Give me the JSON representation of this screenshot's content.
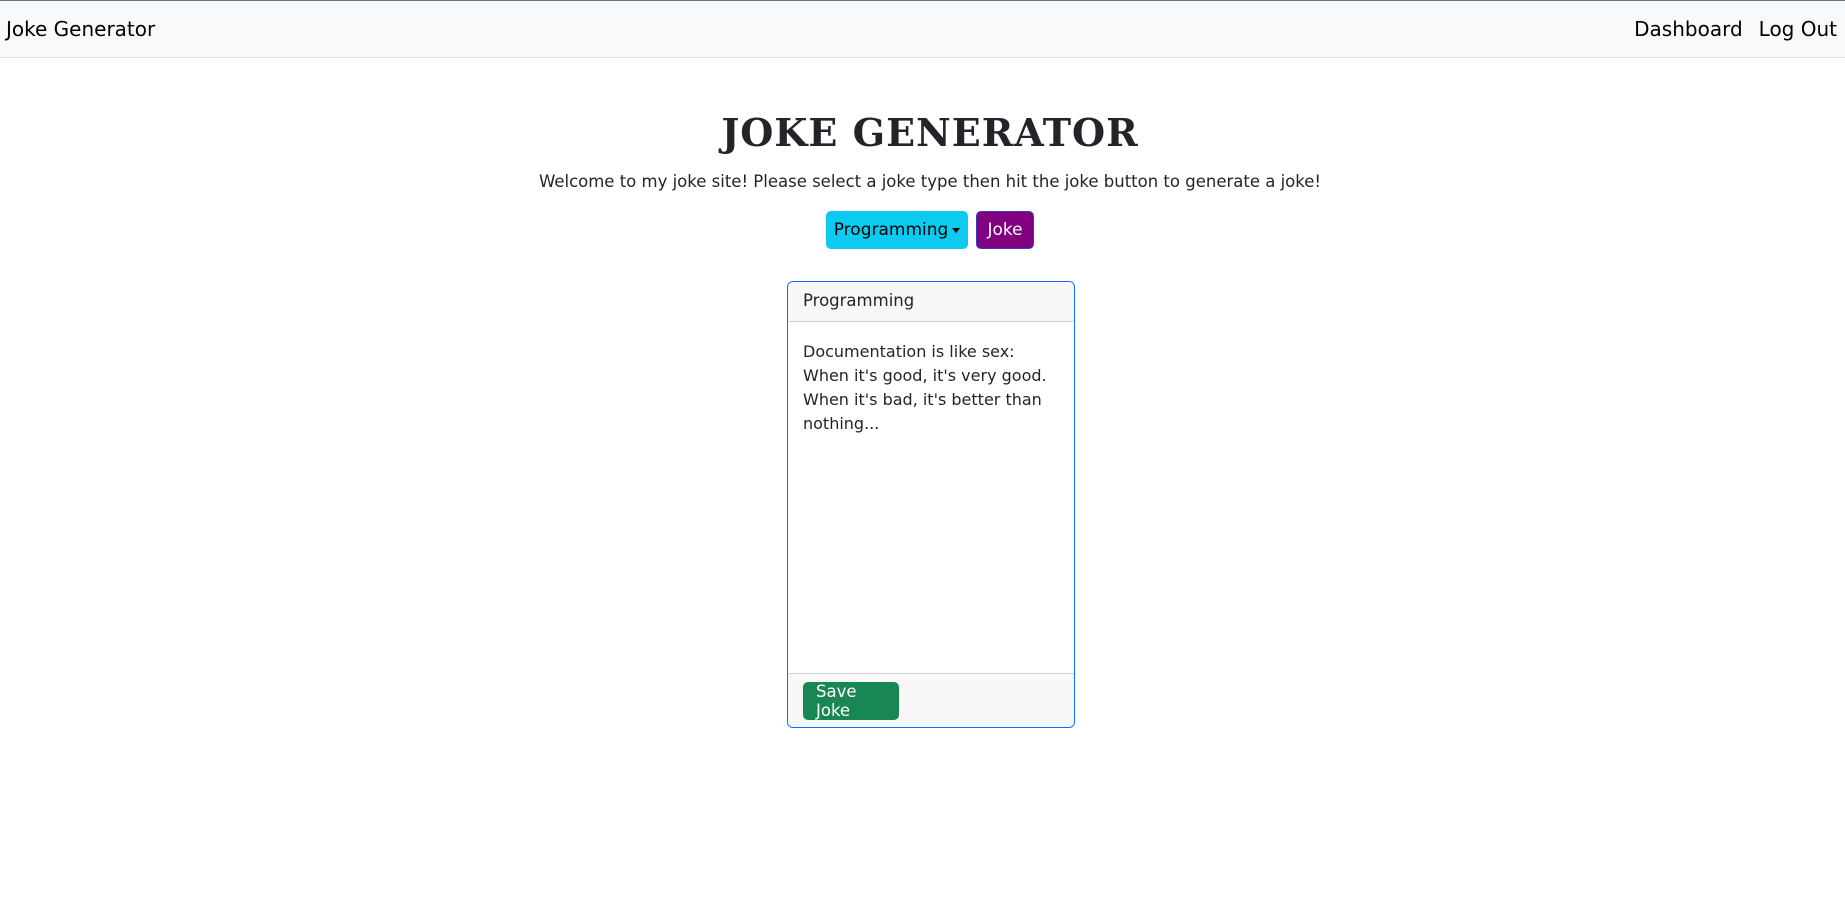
{
  "navbar": {
    "brand": "Joke Generator",
    "links": [
      "Dashboard",
      "Log Out"
    ]
  },
  "main": {
    "title": "JOKE GENERATOR",
    "welcome": "Welcome to my joke site! Please select a joke type then hit the joke button to generate a joke!",
    "joke_type_selected": "Programming",
    "joke_button_label": "Joke"
  },
  "card": {
    "header": "Programming",
    "body": "Documentation is like sex: When it's good, it's very good. When it's bad, it's better than nothing...",
    "save_label": "Save Joke"
  },
  "colors": {
    "dropdown": "#0dcaf0",
    "joke_button": "#800080",
    "save_button": "#198754",
    "card_border": "#0d6efd"
  }
}
